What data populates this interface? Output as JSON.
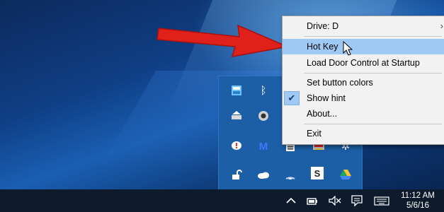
{
  "menu": {
    "items": [
      {
        "label": "Drive: D",
        "submenu_arrow": "›"
      },
      {
        "label": "Hot Key",
        "highlighted": true
      },
      {
        "label": "Load Door Control at Startup"
      },
      {
        "label": "Set button colors"
      },
      {
        "label": "Show hint",
        "checked": true
      },
      {
        "label": "About..."
      },
      {
        "label": "Exit"
      }
    ]
  },
  "tray_overflow": {
    "icons": [
      "windows-defender-icon",
      "bluetooth-icon",
      "drive-eject-icon",
      "webcam-icon",
      "chat-bubble-icon",
      "malwarebytes-icon",
      "notepad-icon",
      "door-control-icon",
      "settings-gear-icon",
      "unlock-icon",
      "onedrive-cloud-icon",
      "wifi-icon",
      "sharefile-icon",
      "google-drive-icon"
    ]
  },
  "taskbar": {
    "time": "11:12 AM",
    "date": "5/6/16",
    "icons": [
      "show-hidden-icons-chevron",
      "power-battery-icon",
      "volume-muted-icon",
      "action-center-icon",
      "keyboard-icon"
    ]
  },
  "colors": {
    "menu_background": "#f2f2f2",
    "menu_highlight": "#9ec9f5",
    "tray_panel": "#1c5fa6",
    "taskbar": "#0e1b2d",
    "arrow": "#e0201b"
  }
}
